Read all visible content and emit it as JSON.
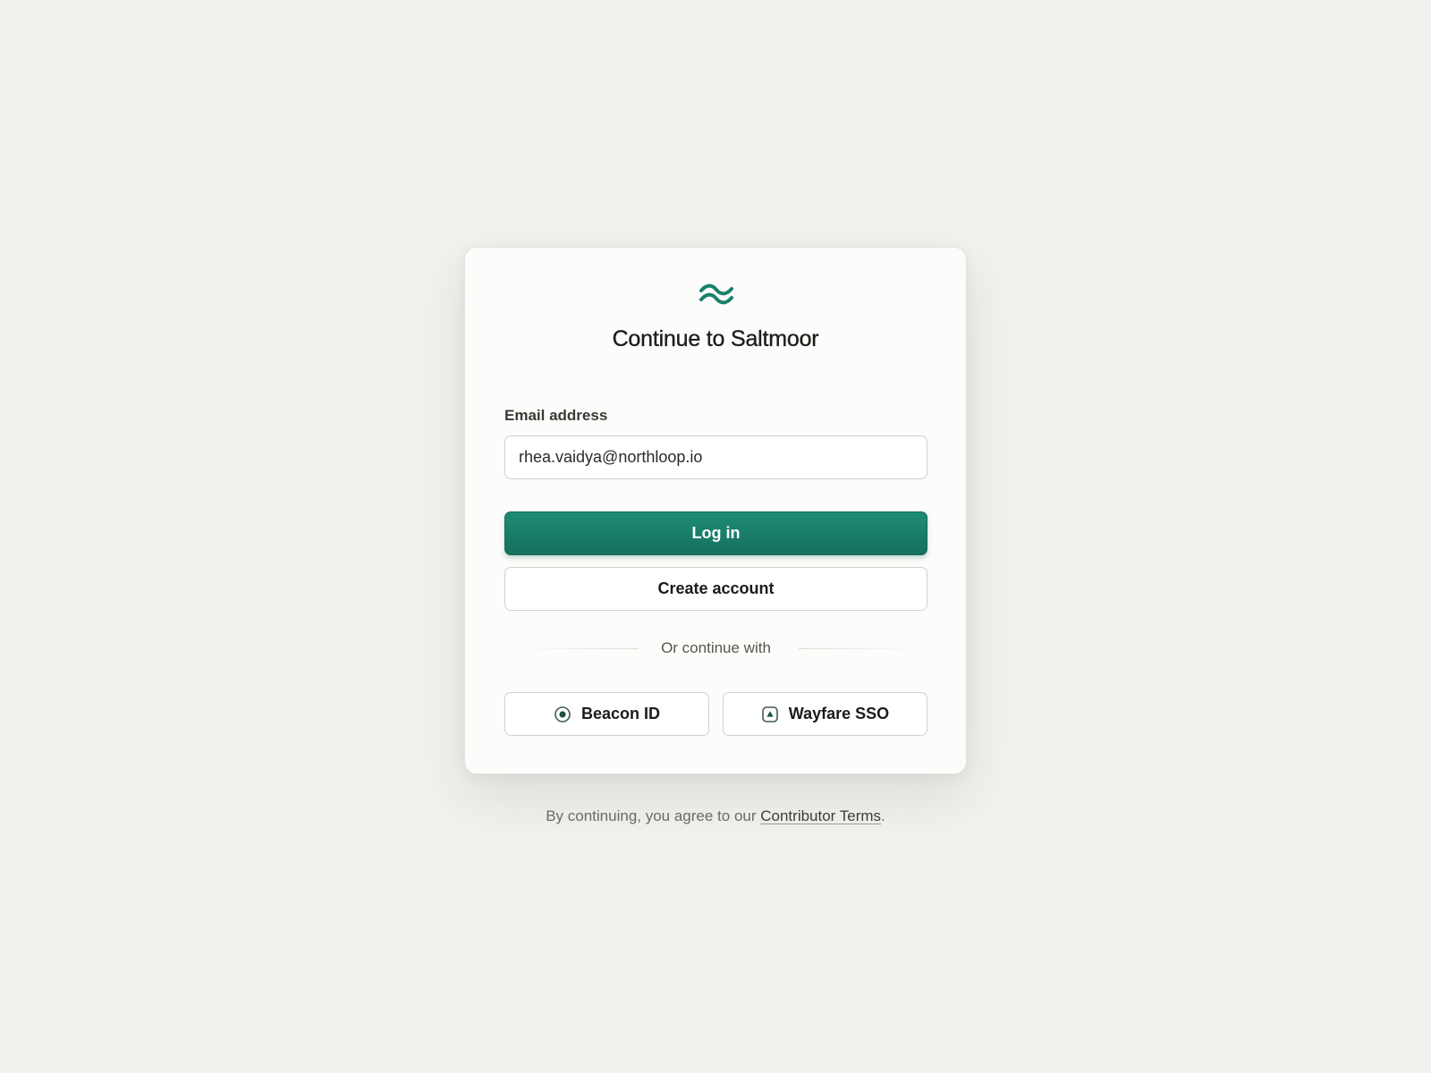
{
  "app": {
    "brand_icon": "wave-logo-icon",
    "title": "Continue to Saltmoor",
    "accent_color": "#1a7f6b"
  },
  "form": {
    "email_label": "Email address",
    "email_value": "rhea.vaidya@northloop.io",
    "login_label": "Log in",
    "create_account_label": "Create account",
    "divider_text": "Or continue with"
  },
  "sso": {
    "providers": [
      {
        "label": "Beacon ID",
        "icon": "radio-target-icon"
      },
      {
        "label": "Wayfare SSO",
        "icon": "triangle-box-icon"
      }
    ]
  },
  "footer": {
    "prefix": "By continuing, you agree to our ",
    "terms_link": "Contributor Terms",
    "suffix": "."
  }
}
